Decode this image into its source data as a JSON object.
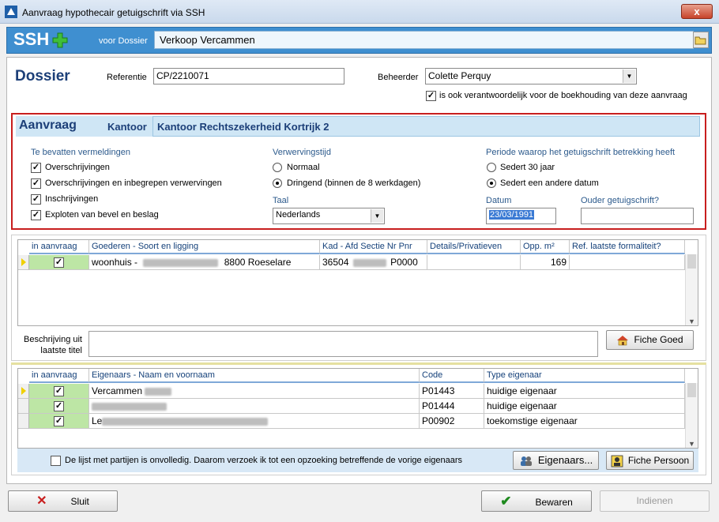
{
  "window": {
    "title": "Aanvraag hypothecair getuigschrift via SSH",
    "close": "x"
  },
  "header": {
    "logo": "SSH",
    "voor_label": "voor Dossier",
    "dossier_name": "Verkoop Vercammen"
  },
  "dossier": {
    "title": "Dossier",
    "referentie_label": "Referentie",
    "referentie_value": "CP/2210071",
    "beheerder_label": "Beheerder",
    "beheerder_value": "Colette Perquy",
    "verantwoordelijk_label": "is ook verantwoordelijk voor de boekhouding van deze aanvraag",
    "verantwoordelijk_checked": true
  },
  "aanvraag": {
    "title": "Aanvraag",
    "kantoor_label": "Kantoor",
    "kantoor_value": "Kantoor Rechtszekerheid Kortrijk 2",
    "vermeldingen_title": "Te bevatten vermeldingen",
    "vermeldingen": [
      {
        "label": "Overschrijvingen",
        "checked": true
      },
      {
        "label": "Overschrijvingen en inbegrepen verwervingen",
        "checked": true
      },
      {
        "label": "Inschrijvingen",
        "checked": true
      },
      {
        "label": "Exploten van bevel en beslag",
        "checked": true
      }
    ],
    "verwerving_title": "Verwervingstijd",
    "verwerving_options": [
      {
        "label": "Normaal",
        "selected": false
      },
      {
        "label": "Dringend (binnen de 8 werkdagen)",
        "selected": true
      }
    ],
    "taal_label": "Taal",
    "taal_value": "Nederlands",
    "periode_title": "Periode waarop het getuigschrift betrekking heeft",
    "periode_options": [
      {
        "label": "Sedert 30 jaar",
        "selected": false
      },
      {
        "label": "Sedert een andere datum",
        "selected": true
      }
    ],
    "datum_label": "Datum",
    "datum_value": "23/03/1991",
    "ouder_label": "Ouder getuigschrift?",
    "ouder_value": ""
  },
  "goederen": {
    "columns": [
      "in aanvraag",
      "Goederen - Soort en ligging",
      "Kad - Afd Sectie Nr Pnr",
      "Details/Privatieven",
      "Opp. m²",
      "Ref. laatste formaliteit?"
    ],
    "rows": [
      {
        "checked": true,
        "soort": "woonhuis  -",
        "plaats": "8800 Roeselare",
        "kad": "36504",
        "pnr": "P0000",
        "details": "",
        "opp": "169",
        "ref": ""
      }
    ],
    "beschrijving_label_1": "Beschrijving uit",
    "beschrijving_label_2": "laatste titel",
    "fiche_goed": "Fiche Goed"
  },
  "eigenaars": {
    "columns": [
      "in aanvraag",
      "Eigenaars - Naam en voornaam",
      "Code",
      "Type eigenaar"
    ],
    "rows": [
      {
        "checked": true,
        "naam": "Vercammen",
        "code": "P01443",
        "type": "huidige eigenaar"
      },
      {
        "checked": true,
        "naam": "",
        "code": "P01444",
        "type": "huidige eigenaar"
      },
      {
        "checked": true,
        "naam": "Le",
        "code": "P00902",
        "type": "toekomstige eigenaar"
      }
    ],
    "onvolledig_label": "De lijst met partijen is onvolledig. Daarom verzoek ik tot een opzoeking betreffende de vorige eigenaars",
    "onvolledig_checked": false,
    "eigenaars_button": "Eigenaars...",
    "fiche_persoon": "Fiche Persoon"
  },
  "footer": {
    "sluit": "Sluit",
    "bewaren": "Bewaren",
    "indienen": "Indienen"
  }
}
